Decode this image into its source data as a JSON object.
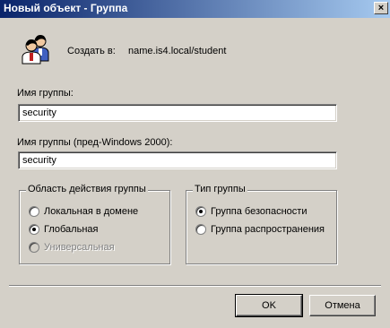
{
  "window": {
    "title": "Новый объект - Группа",
    "close_glyph": "×"
  },
  "header": {
    "create_in_label": "Создать в:",
    "create_in_value": "name.is4.local/student",
    "icon": "users-icon"
  },
  "fields": {
    "group_name_label": "Имя группы:",
    "group_name_value": "security",
    "group_name_prewin_label": "Имя группы (пред-Windows 2000):",
    "group_name_prewin_value": "security"
  },
  "scope": {
    "legend": "Область действия группы",
    "options": [
      {
        "label": "Локальная в домене",
        "checked": false,
        "disabled": false
      },
      {
        "label": "Глобальная",
        "checked": true,
        "disabled": false
      },
      {
        "label": "Универсальная",
        "checked": false,
        "disabled": true
      }
    ]
  },
  "type": {
    "legend": "Тип группы",
    "options": [
      {
        "label": "Группа безопасности",
        "checked": true,
        "disabled": false
      },
      {
        "label": "Группа распространения",
        "checked": false,
        "disabled": false
      }
    ]
  },
  "buttons": {
    "ok": "OK",
    "cancel": "Отмена"
  }
}
